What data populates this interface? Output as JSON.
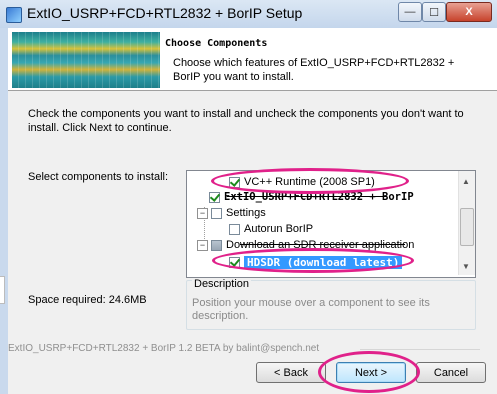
{
  "window": {
    "title": "ExtIO_USRP+FCD+RTL2832 + BorIP Setup",
    "minimize_glyph": "—",
    "maximize_glyph": "☐",
    "close_glyph": "X",
    "icon": "installer-icon"
  },
  "header": {
    "title": "Choose Components",
    "description": "Choose which features of ExtIO_USRP+FCD+RTL2832 + BorIP you want to install.",
    "banner_icon": "spectrum-waterfall-banner"
  },
  "body": {
    "intro": "Check the components you want to install and uncheck the components you don't want to install. Click Next to continue.",
    "select_label": "Select components to install:",
    "space_required": "Space required: 24.6MB"
  },
  "tree": {
    "items": [
      {
        "label": "VC++ Runtime (2008 SP1)",
        "checked": true
      },
      {
        "label": "ExtIO_USRP+FCD+RTL2832 + BorIP",
        "checked": true
      },
      {
        "label": "Settings",
        "checked": false
      },
      {
        "label": "Autorun BorIP",
        "checked": false
      },
      {
        "label": "Download an SDR receiver application",
        "checked": "partial"
      },
      {
        "label": "HDSDR (download latest)",
        "checked": true
      }
    ],
    "expand_glyph": "−",
    "scroll_up_glyph": "▲",
    "scroll_down_glyph": "▼"
  },
  "description": {
    "legend": "Description",
    "text": "Position your mouse over a component to see its description."
  },
  "footer": {
    "brand": "ExtIO_USRP+FCD+RTL2832 + BorIP 1.2 BETA by balint@spench.net"
  },
  "buttons": {
    "back": "< Back",
    "next": "Next >",
    "cancel": "Cancel"
  },
  "colors": {
    "highlight": "#3399ff",
    "annotation": "#e0218a"
  }
}
